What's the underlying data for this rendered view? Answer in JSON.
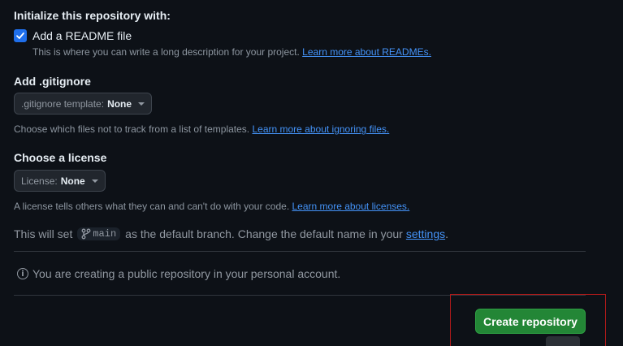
{
  "init": {
    "heading": "Initialize this repository with:",
    "readme_label": "Add a README file",
    "readme_checked": true,
    "readme_help": "This is where you can write a long description for your project.",
    "readme_link": "Learn more about READMEs."
  },
  "gitignore": {
    "heading": "Add .gitignore",
    "dropdown_label": ".gitignore template:",
    "dropdown_value": "None",
    "help": "Choose which files not to track from a list of templates.",
    "link": "Learn more about ignoring files."
  },
  "license": {
    "heading": "Choose a license",
    "dropdown_label": "License:",
    "dropdown_value": "None",
    "help": "A license tells others what they can and can't do with your code.",
    "link": "Learn more about licenses."
  },
  "branch": {
    "prefix": "This will set",
    "name": "main",
    "suffix": "as the default branch. Change the default name in your",
    "settings_link": "settings",
    "end": "."
  },
  "notice": {
    "text": "You are creating a public repository in your personal account."
  },
  "actions": {
    "create_label": "Create repository"
  },
  "colors": {
    "background": "#0d1117",
    "link": "#4493f8",
    "primary_button": "#238636",
    "highlight_border": "#b01a1a"
  }
}
